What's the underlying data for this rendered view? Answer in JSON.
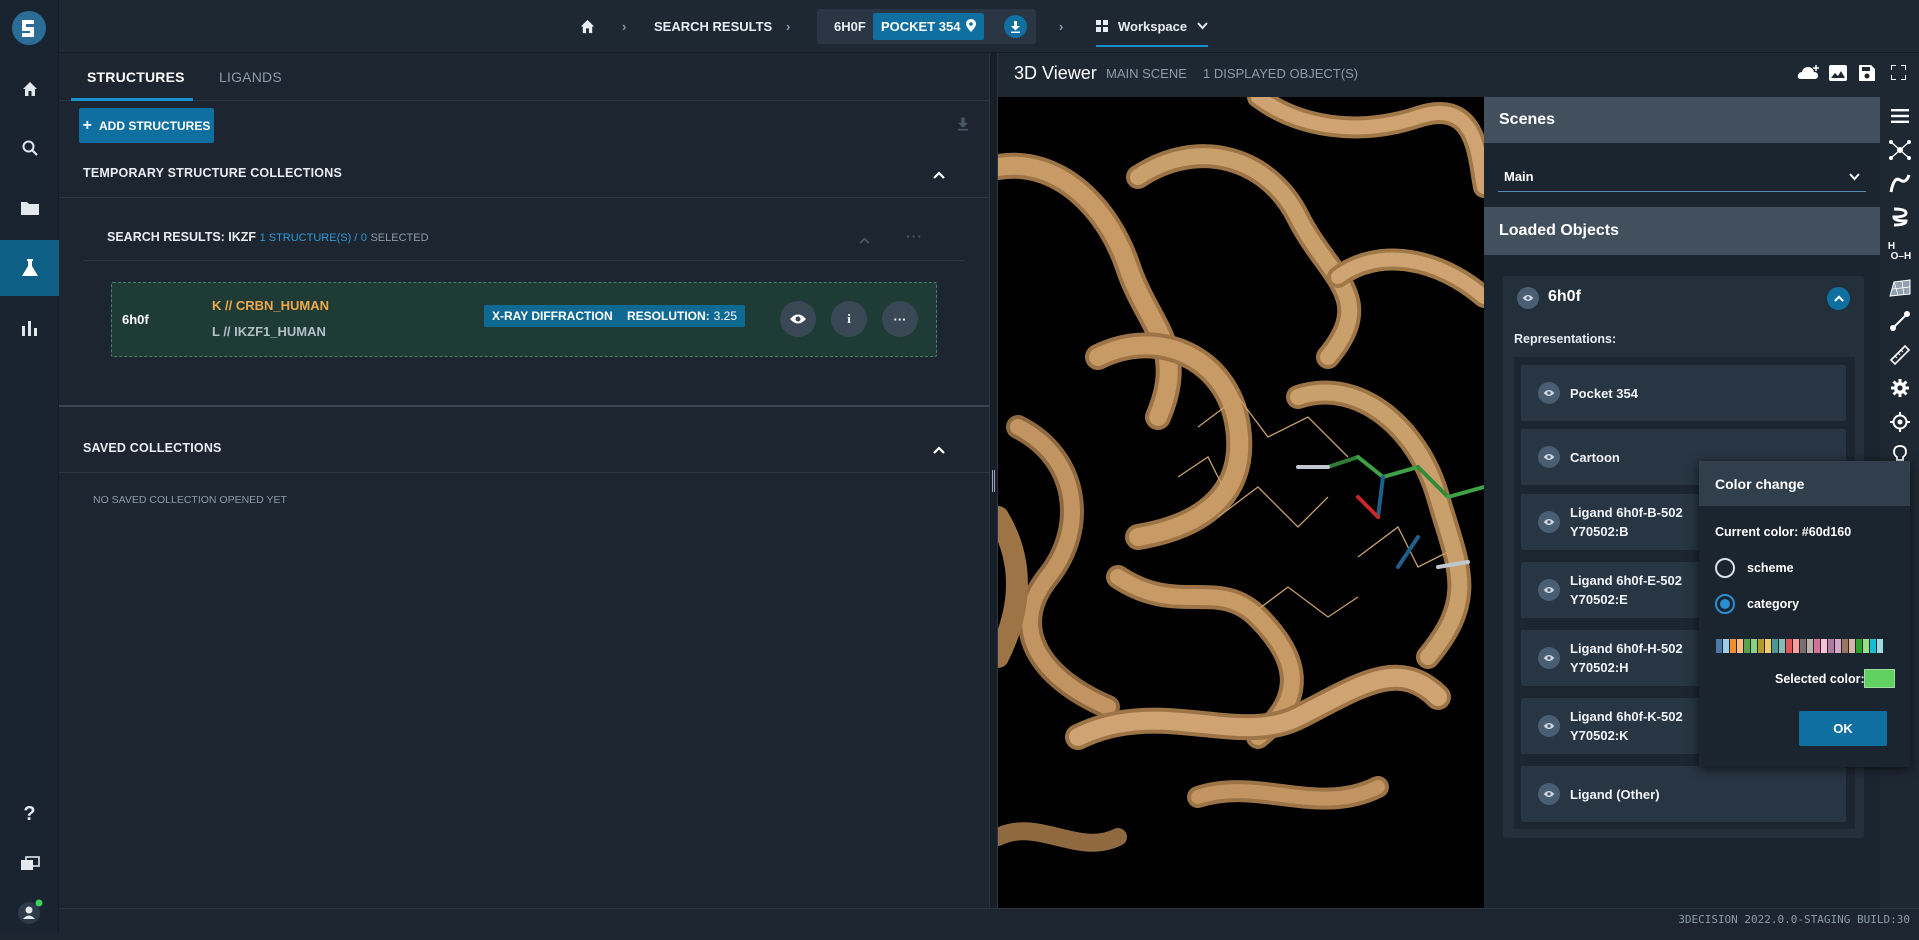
{
  "breadcrumb": {
    "search_results": "SEARCH RESULTS",
    "structure_id": "6H0F",
    "pocket": "POCKET 354",
    "workspace": "Workspace"
  },
  "structures_panel": {
    "tabs": [
      {
        "label": "STRUCTURES",
        "active": true
      },
      {
        "label": "LIGANDS",
        "active": false
      }
    ],
    "add_button": "ADD STRUCTURES",
    "temp_collections_title": "TEMPORARY STRUCTURE COLLECTIONS",
    "search_results": {
      "title": "SEARCH RESULTS: IKZF",
      "count": "1 STRUCTURE(S) /",
      "selected_num": "0",
      "selected_label": "SELECTED"
    },
    "card": {
      "id": "6h0f",
      "chain_k": "K // CRBN_HUMAN",
      "chain_l": "L // IKZF1_HUMAN",
      "method_tag": "X-RAY DIFFRACTION",
      "resolution_label": "RESOLUTION:",
      "resolution_value": "3.25"
    },
    "saved_collections_title": "SAVED COLLECTIONS",
    "saved_empty": "NO SAVED COLLECTION OPENED YET"
  },
  "viewer": {
    "title": "3D Viewer",
    "scene_label": "MAIN SCENE",
    "displayed": "1 DISPLAYED OBJECT(S)"
  },
  "scenes": {
    "title": "Scenes",
    "selected_scene": "Main",
    "loaded_objects_title": "Loaded Objects",
    "object_name": "6h0f",
    "representations_label": "Representations:",
    "representations": [
      {
        "line1": "Pocket 354",
        "line2": ""
      },
      {
        "line1": "Cartoon",
        "line2": ""
      },
      {
        "line1": "Ligand 6h0f-B-502",
        "line2": "Y70502:B"
      },
      {
        "line1": "Ligand 6h0f-E-502",
        "line2": "Y70502:E"
      },
      {
        "line1": "Ligand 6h0f-H-502",
        "line2": "Y70502:H"
      },
      {
        "line1": "Ligand 6h0f-K-502",
        "line2": "Y70502:K"
      },
      {
        "line1": "Ligand (Other)",
        "line2": ""
      }
    ]
  },
  "color_popup": {
    "title": "Color change",
    "current_color_label": "Current color: #60d160",
    "options": [
      {
        "label": "scheme",
        "checked": false
      },
      {
        "label": "category",
        "checked": true
      }
    ],
    "selected_color_label": "Selected color:",
    "selected_color": "#60d160",
    "ok": "OK",
    "palette": [
      "#4e79a7",
      "#a0cbe8",
      "#f28e2b",
      "#ffbe7d",
      "#59a14f",
      "#8cd17d",
      "#b6992d",
      "#f1ce63",
      "#499894",
      "#86bcb6",
      "#e15759",
      "#ff9d9a",
      "#79706e",
      "#bab0ac",
      "#d37295",
      "#fabfd2",
      "#b07aa1",
      "#d4a6c8",
      "#9d7660",
      "#d7b5a6",
      "#2ca02c",
      "#98df8a",
      "#17becf",
      "#9edae5"
    ]
  },
  "colors": {
    "accent": "#0f6fa0",
    "ribbon": "#c79a66",
    "chain_k": "#f0a84a",
    "chain_l": "#b4bfca",
    "selected_num": "#2f9bd6"
  },
  "footer": {
    "build": "3DECISION 2022.0.0-STAGING BUILD:30"
  }
}
